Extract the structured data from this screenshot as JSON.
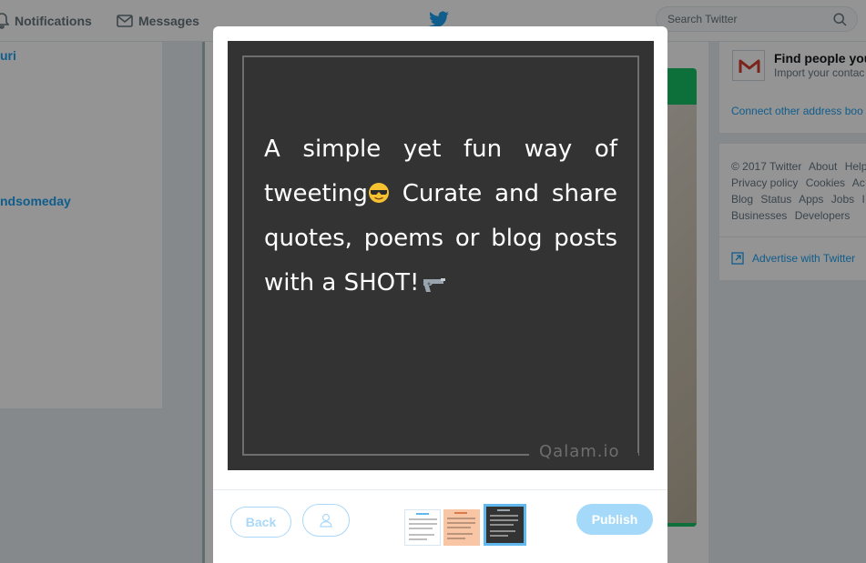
{
  "nav": {
    "notifications_label": "Notifications",
    "messages_label": "Messages",
    "search_placeholder": "Search Twitter"
  },
  "left": {
    "link_1": "uri",
    "link_2": "ndsomeday"
  },
  "right": {
    "find_title": "Find people you",
    "find_subtitle": "Import your contac",
    "connect_link": "Connect other address boo",
    "footer_links": [
      "© 2017 Twitter",
      "About",
      "Help",
      "Privacy policy",
      "Cookies",
      "Ac",
      "Blog",
      "Status",
      "Apps",
      "Jobs",
      "I",
      "Businesses",
      "Developers"
    ],
    "advertise": "Advertise with Twitter"
  },
  "modal": {
    "preview": {
      "text_part1": "A simple yet fun way of tweeting",
      "text_part2": " Curate and share quotes, poems or blog posts with a SHOT!",
      "watermark": "Qalam.io"
    },
    "back_label": "Back",
    "publish_label": "Publish",
    "thumbnails": [
      "light theme",
      "peach theme",
      "dark theme"
    ],
    "selected_thumbnail": "dark theme"
  },
  "colors": {
    "twitter_blue": "#1da1f2",
    "publish_disabled": "#a5d9fa",
    "preview_background": "#333333",
    "selected_border": "#60b8ee"
  },
  "icons": {
    "notifications": "bell-icon",
    "messages": "envelope-icon",
    "logo": "twitter-bird-icon",
    "search": "search-icon",
    "avatar_button": "user-icon",
    "advertise": "external-link-icon"
  }
}
